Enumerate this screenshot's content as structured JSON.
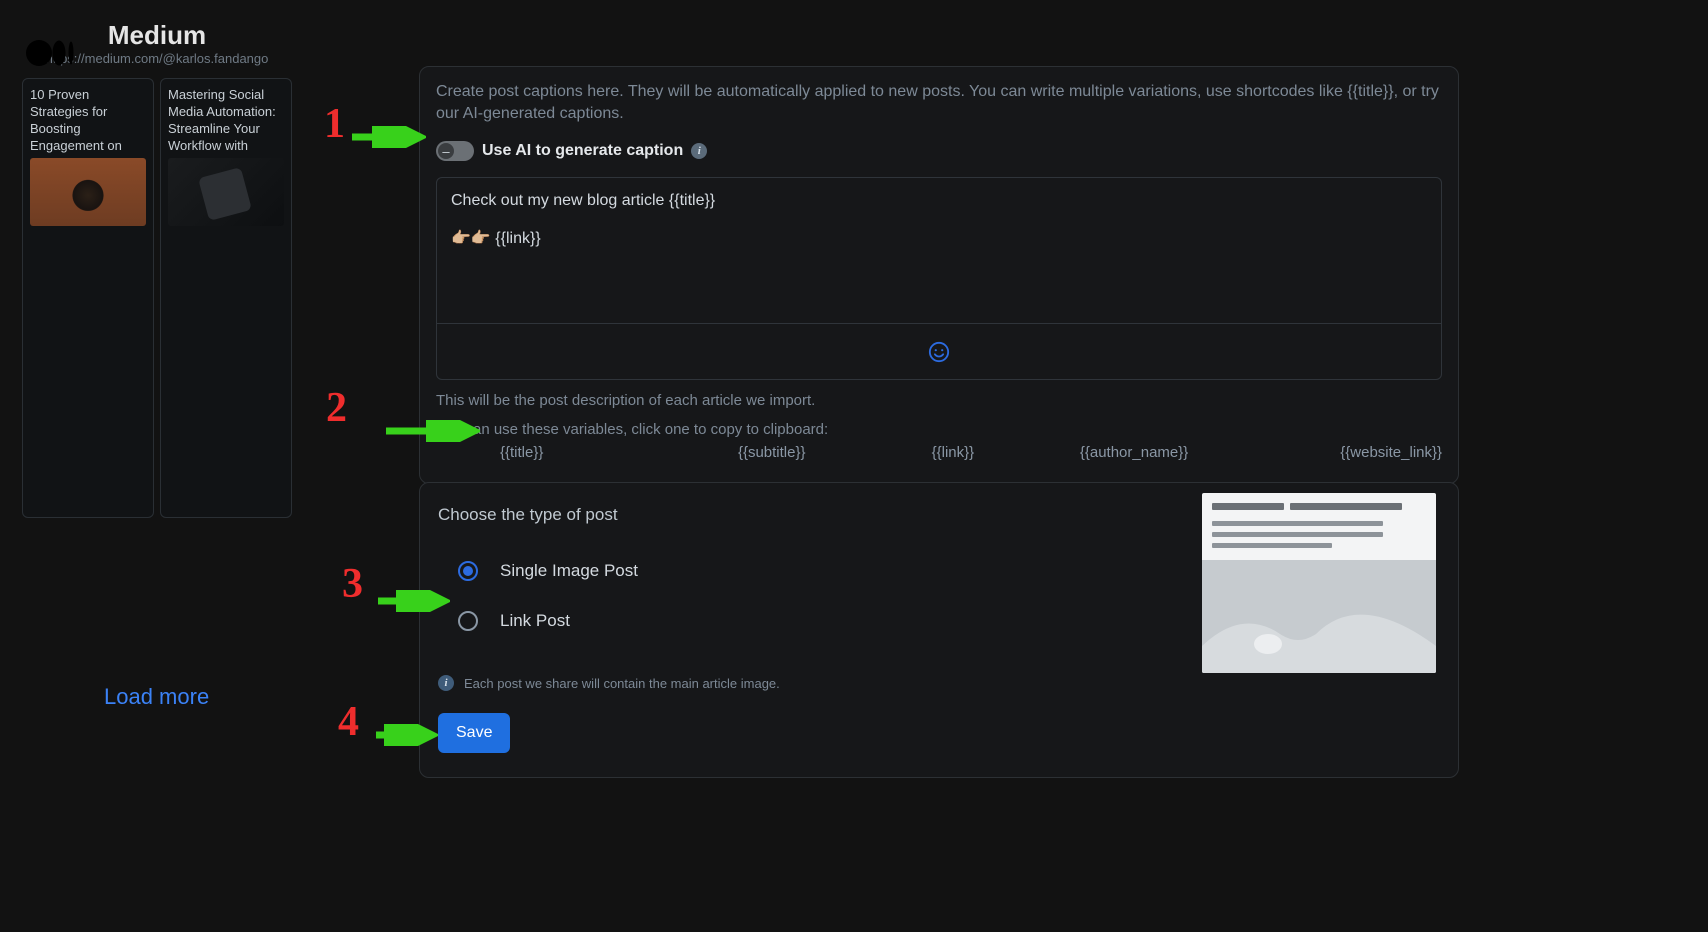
{
  "brand": {
    "title": "Medium",
    "url": "https://medium.com/@karlos.fandango"
  },
  "cards": [
    {
      "title": "10 Proven Strategies for Boosting Engagement on"
    },
    {
      "title": "Mastering Social Media Automation: Streamline Your Workflow with"
    }
  ],
  "load_more": "Load more",
  "captions_panel": {
    "intro": "Create post captions here. They will be automatically applied to new posts. You can write multiple variations, use shortcodes like {{title}}, or try our AI-generated captions.",
    "ai_label": "Use AI to generate caption",
    "caption_text": "Check out my new blog article {{title}}\n\n👉🏼👉🏼 {{link}}",
    "help1": "This will be the post description of each article we import.",
    "help2": "You can use these variables, click one to copy to clipboard:",
    "vars": [
      "{{title}}",
      "{{subtitle}}",
      "{{link}}",
      "{{author_name}}",
      "{{website_link}}"
    ]
  },
  "post_type_panel": {
    "heading": "Choose the type of post",
    "options": [
      {
        "label": "Single Image Post",
        "selected": true
      },
      {
        "label": "Link Post",
        "selected": false
      }
    ],
    "note": "Each post we share will contain the main article image.",
    "save": "Save"
  },
  "annotations": {
    "n1": "1",
    "n2": "2",
    "n3": "3",
    "n4": "4"
  }
}
